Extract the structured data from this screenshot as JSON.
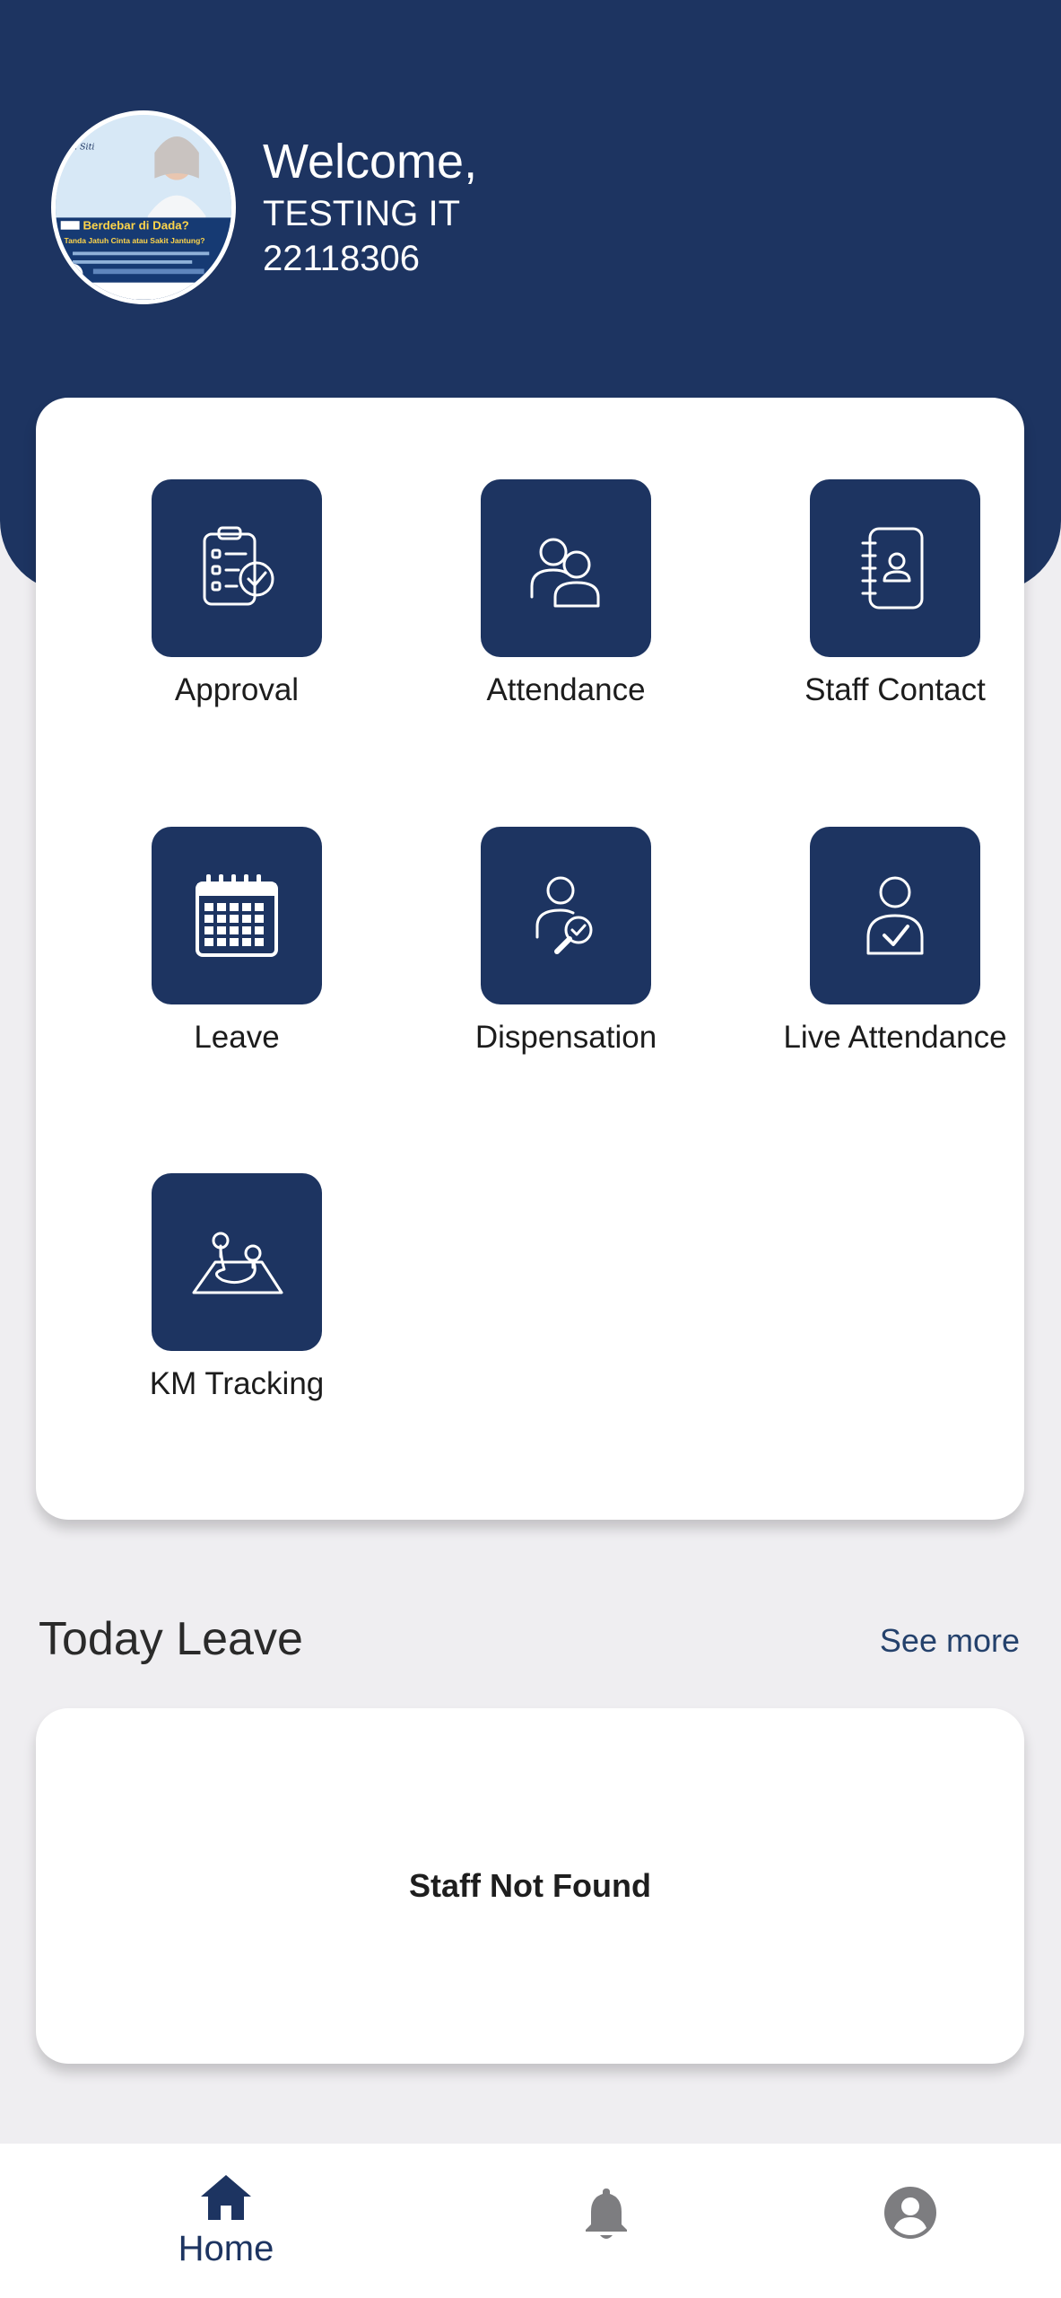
{
  "colors": {
    "brand": "#1d3461",
    "background": "#efeef1",
    "card": "#ffffff",
    "inactive_icon": "#7d7d80"
  },
  "header": {
    "welcome": "Welcome,",
    "name": "TESTING IT",
    "employee_id": "22118306",
    "avatar": {
      "headline": "Berdebar di Dada?",
      "subline": "Tanda Jatuh Cinta atau Sakit Jantung?"
    }
  },
  "menu": {
    "items": [
      {
        "label": "Approval",
        "icon": "checklist-icon"
      },
      {
        "label": "Attendance",
        "icon": "users-icon"
      },
      {
        "label": "Staff Contact",
        "icon": "contact-book-icon"
      },
      {
        "label": "Leave",
        "icon": "calendar-icon"
      },
      {
        "label": "Dispensation",
        "icon": "user-search-icon"
      },
      {
        "label": "Live Attendance",
        "icon": "user-check-icon"
      },
      {
        "label": "KM Tracking",
        "icon": "map-route-icon"
      }
    ]
  },
  "today_leave": {
    "title": "Today Leave",
    "see_more": "See more",
    "empty_text": "Staff Not Found"
  },
  "bottom_nav": {
    "home_label": "Home",
    "home_icon": "home-icon",
    "notifications_icon": "bell-icon",
    "profile_icon": "profile-icon"
  }
}
